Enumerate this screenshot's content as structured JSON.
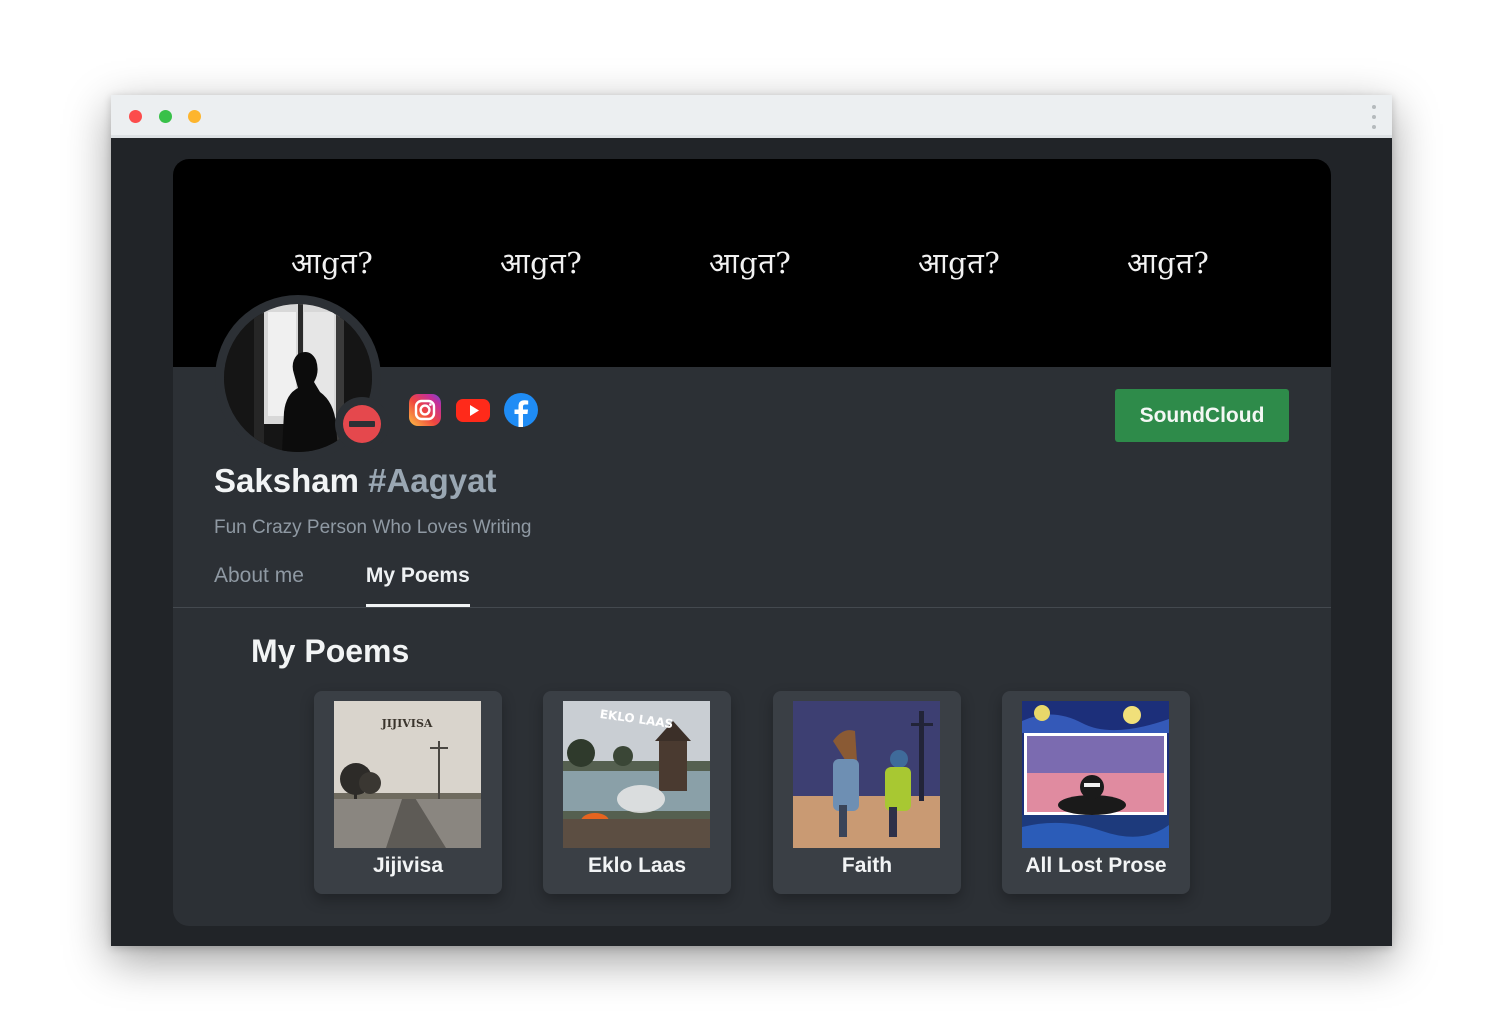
{
  "banner": {
    "words": [
      "आgत?",
      "आgत?",
      "आgत?",
      "आgत?",
      "आgत?"
    ]
  },
  "profile": {
    "name": "Saksham",
    "handle": "#Aagyat",
    "bio": "Fun Crazy Person Who Loves Writing",
    "status_icon": "do-not-disturb-icon"
  },
  "social_links": [
    {
      "icon": "instagram-icon"
    },
    {
      "icon": "youtube-icon"
    },
    {
      "icon": "facebook-icon"
    }
  ],
  "soundcloud_button": {
    "label": "SoundCloud",
    "color": "#2e8b4a"
  },
  "tabs": [
    {
      "label": "About me",
      "active": false
    },
    {
      "label": "My Poems",
      "active": true
    }
  ],
  "poems_section": {
    "title": "My Poems",
    "poems": [
      {
        "title": "Jijivisa",
        "cover_text": "JIJIVISA"
      },
      {
        "title": "Eklo Laas",
        "cover_text": "EKLO LAAS"
      },
      {
        "title": "Faith"
      },
      {
        "title": "All Lost Prose"
      }
    ]
  },
  "colors": {
    "page_background": "#212428",
    "card_background": "#2c3035",
    "banner_background": "#000000",
    "accent_green": "#2e8b4a",
    "status_red": "#e5484d"
  }
}
